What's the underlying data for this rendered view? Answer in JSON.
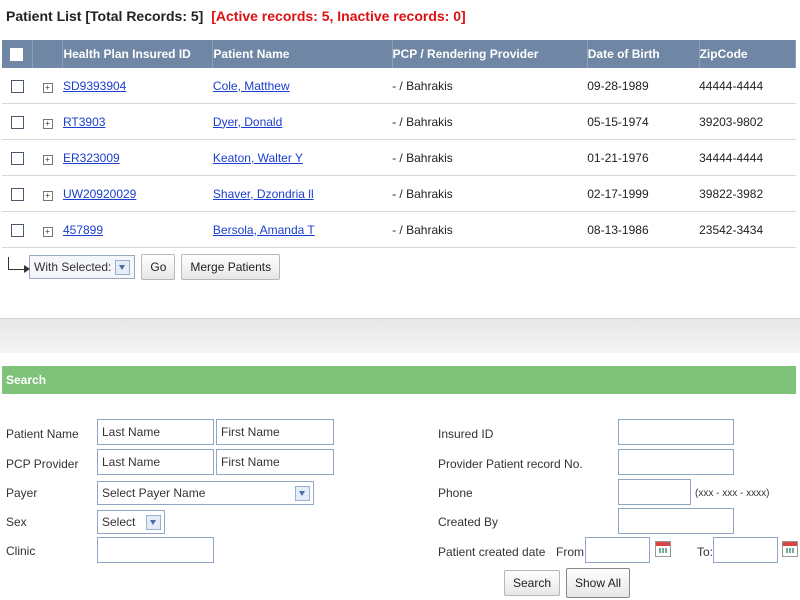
{
  "header": {
    "title": "Patient List",
    "total": "[Total Records: 5]",
    "status": "[Active records: 5,  Inactive records: 0]"
  },
  "table": {
    "columns": [
      "Health Plan Insured ID",
      "Patient Name",
      "PCP / Rendering Provider",
      "Date of Birth",
      "ZipCode"
    ],
    "rows": [
      {
        "id": "SD9393904",
        "name": "Cole, Matthew",
        "pcp": "- / Bahrakis",
        "dob": "09-28-1989",
        "zip": "44444-4444"
      },
      {
        "id": "RT3903",
        "name": "Dyer, Donald",
        "pcp": "- / Bahrakis",
        "dob": "05-15-1974",
        "zip": "39203-9802"
      },
      {
        "id": "ER323009",
        "name": "Keaton, Walter Y",
        "pcp": "- / Bahrakis",
        "dob": "01-21-1976",
        "zip": "34444-4444"
      },
      {
        "id": "UW20920029",
        "name": "Shaver, Dzondria ll",
        "pcp": "- / Bahrakis",
        "dob": "02-17-1999",
        "zip": "39822-3982"
      },
      {
        "id": "457899",
        "name": "Bersola, Amanda T",
        "pcp": "- / Bahrakis",
        "dob": "08-13-1986",
        "zip": "23542-3434"
      }
    ]
  },
  "bulk": {
    "with_selected": "With Selected:",
    "go": "Go",
    "merge": "Merge Patients"
  },
  "search": {
    "title": "Search",
    "patient_name_label": "Patient Name",
    "last_name_ph": "Last Name",
    "first_name_ph": "First Name",
    "pcp_label": "PCP Provider",
    "payer_label": "Payer",
    "payer_value": "Select Payer Name",
    "sex_label": "Sex",
    "sex_value": "Select",
    "clinic_label": "Clinic",
    "insured_id_label": "Insured ID",
    "provider_record_label": "Provider Patient record No.",
    "phone_label": "Phone",
    "phone_hint": "(xxx - xxx - xxxx)",
    "created_by_label": "Created By",
    "created_date_label": "Patient created date",
    "from_label": "From:",
    "to_label": "To:",
    "search_button": "Search",
    "show_all_button": "Show All"
  }
}
